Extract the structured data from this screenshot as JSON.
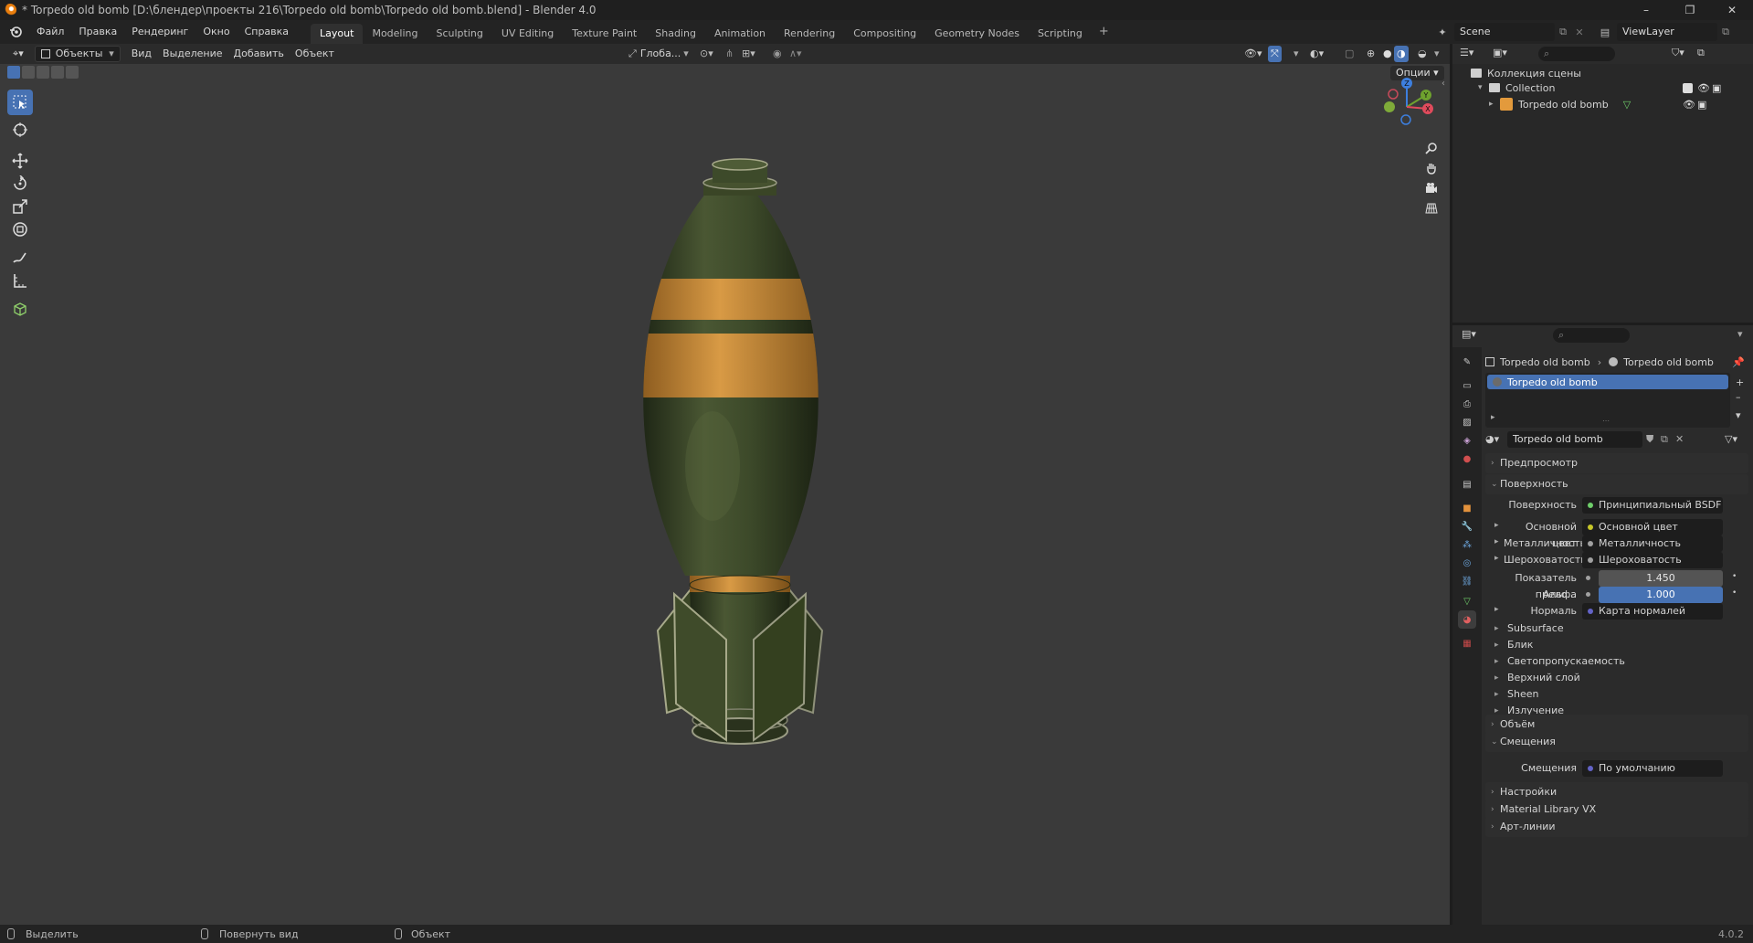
{
  "window": {
    "title": "* Torpedo old bomb [D:\\блендер\\проекты 216\\Torpedo old bomb\\Torpedo old bomb.blend] - Blender 4.0",
    "minimize": "–",
    "maximize": "❐",
    "close": "✕"
  },
  "menu": {
    "file": "Файл",
    "edit": "Правка",
    "render": "Рендеринг",
    "window": "Окно",
    "help": "Справка"
  },
  "workspaces": [
    "Layout",
    "Modeling",
    "Sculpting",
    "UV Editing",
    "Texture Paint",
    "Shading",
    "Animation",
    "Rendering",
    "Compositing",
    "Geometry Nodes",
    "Scripting"
  ],
  "workspace_add": "+",
  "scene": {
    "name": "Scene",
    "view_layer": "ViewLayer"
  },
  "viewport_header": {
    "mode": "Объекты",
    "view": "Вид",
    "select": "Выделение",
    "add": "Добавить",
    "object": "Объект",
    "orientation": "Глоба...",
    "options": "Опции"
  },
  "outliner": {
    "scene_collection": "Коллекция сцены",
    "collection": "Collection",
    "object": "Torpedo old bomb"
  },
  "properties": {
    "breadcrumb_object": "Torpedo old bomb",
    "breadcrumb_material": "Torpedo old bomb",
    "slot_name": "Torpedo old bomb",
    "material_name": "Torpedo old bomb",
    "panels": {
      "preview": "Предпросмотр",
      "surface": "Поверхность",
      "volume": "Объём",
      "displacement": "Смещения",
      "settings": "Настройки",
      "material_library": "Material Library VX",
      "lineart": "Арт-линии"
    },
    "surface_label": "Поверхность",
    "surface_value": "Принципиальный BSDF",
    "inputs": [
      {
        "label": "Основной цвет",
        "value": "Основной цвет",
        "dot": "#c7c729"
      },
      {
        "label": "Металличность",
        "value": "Металличность",
        "dot": "#a1a1a1"
      },
      {
        "label": "Шероховатость",
        "value": "Шероховатость",
        "dot": "#a1a1a1"
      }
    ],
    "ior_label": "Показатель прело...",
    "ior_value": "1.450",
    "alpha_label": "Альфа",
    "alpha_value": "1.000",
    "normal_label": "Нормаль",
    "normal_value": "Карта нормалей",
    "subpanels": [
      "Subsurface",
      "Блик",
      "Светопропускаемость",
      "Верхний слой",
      "Sheen",
      "Излучение"
    ],
    "displacement_label": "Смещения",
    "displacement_value": "По умолчанию"
  },
  "statusbar": {
    "select": "Выделить",
    "rotate": "Повернуть вид",
    "object": "Объект",
    "version": "4.0.2"
  },
  "colors": {
    "accent": "#4772b3",
    "viewport_bg": "#3a3a3a",
    "bomb_green": "#3f4a2c",
    "bomb_orange": "#c98a34"
  }
}
